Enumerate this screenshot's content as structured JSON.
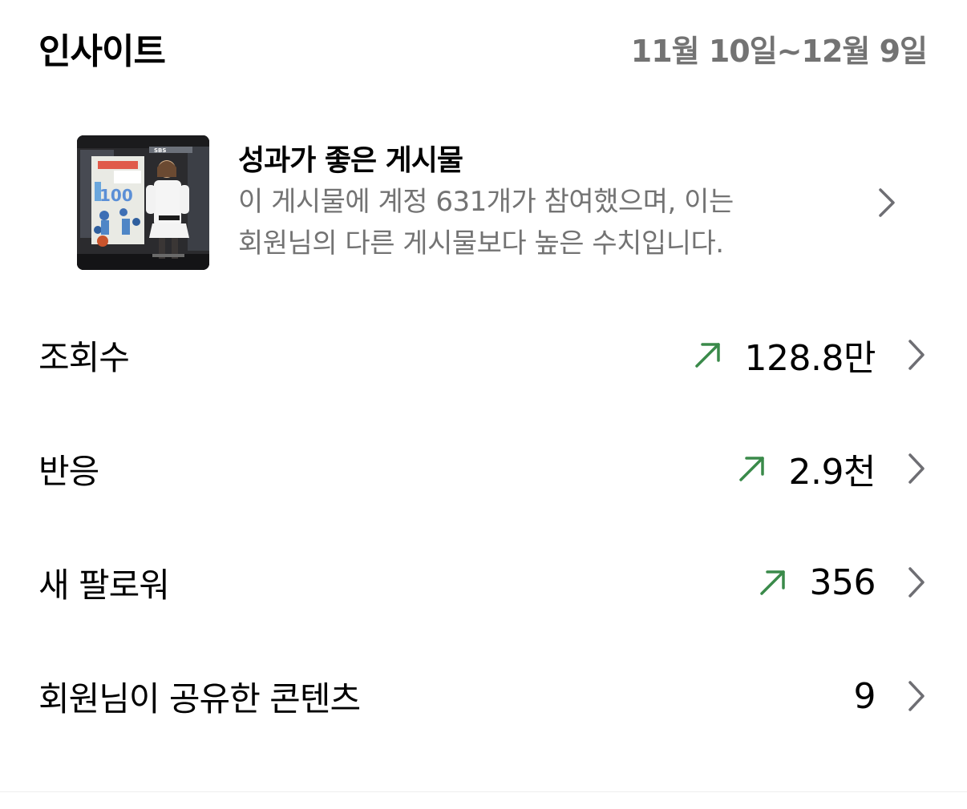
{
  "header": {
    "title": "인사이트",
    "date_range": "11월 10일~12월 9일"
  },
  "top_post": {
    "title": "성과가 좋은 게시물",
    "description_line1": "이 게시물에 계정 631개가 참여했으며, 이는",
    "description_line2": "회원님의 다른 게시물보다 높은 수치입니다.",
    "thumbnail_text": {
      "broadcaster": "SBS",
      "badge": "100"
    }
  },
  "metrics": [
    {
      "label": "조회수",
      "value": "128.8만",
      "trend": "up"
    },
    {
      "label": "반응",
      "value": "2.9천",
      "trend": "up"
    },
    {
      "label": "새 팔로워",
      "value": "356",
      "trend": "up"
    },
    {
      "label": "회원님이 공유한 콘텐츠",
      "value": "9",
      "trend": "none"
    }
  ],
  "colors": {
    "trend_up": "#3a8a4a",
    "secondary_text": "#737373",
    "chevron": "#6e6e73"
  },
  "icons": {
    "trend": "arrow-up-right-icon",
    "row_action": "chevron-right-icon"
  }
}
